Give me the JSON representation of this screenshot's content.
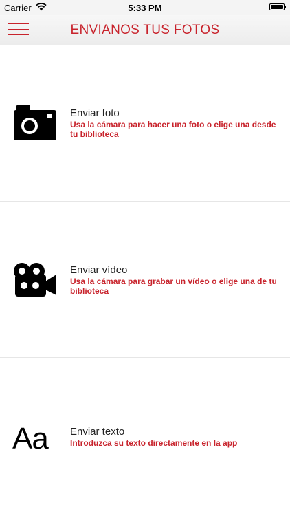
{
  "status_bar": {
    "carrier": "Carrier",
    "time": "5:33 PM",
    "battery_level": 1.0
  },
  "nav": {
    "title": "ENVIANOS TUS FOTOS",
    "menu_icon": "hamburger-menu-icon"
  },
  "rows": [
    {
      "icon": "camera-icon",
      "title": "Enviar foto",
      "description": "Usa la cámara para hacer una foto o elige una desde tu biblioteca"
    },
    {
      "icon": "video-camera-icon",
      "title": "Enviar vídeo",
      "description": "Usa la cámara para grabar un vídeo o elige una de tu biblioteca"
    },
    {
      "icon": "text-icon",
      "icon_glyph": "Aa",
      "title": "Enviar texto",
      "description": "Introduzca su texto directamente en la app"
    }
  ],
  "colors": {
    "accent": "#c8232c",
    "text": "#222222",
    "divider": "#e6e6e6"
  }
}
